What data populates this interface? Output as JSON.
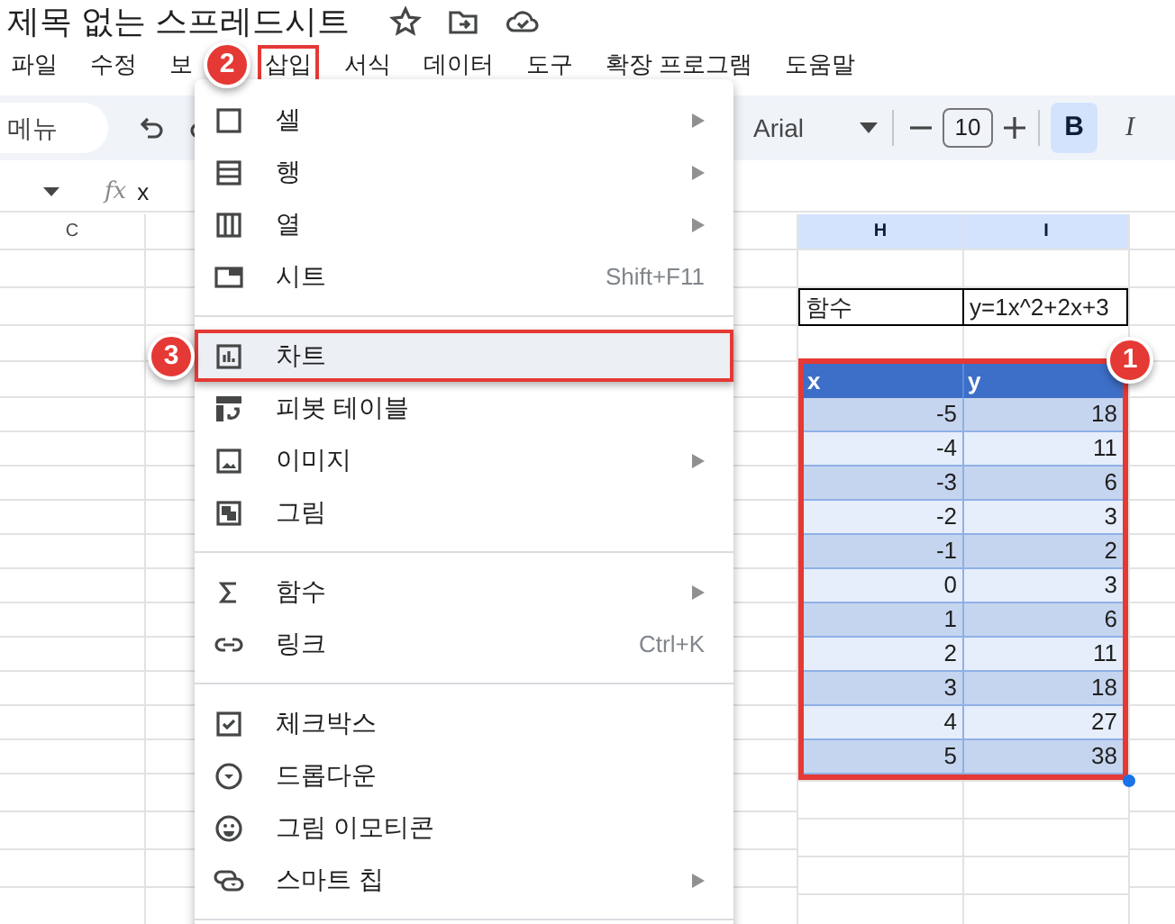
{
  "document": {
    "title": "제목 없는 스프레드시트"
  },
  "menubar": [
    {
      "label": "파일",
      "outlined": false
    },
    {
      "label": "수정",
      "outlined": false
    },
    {
      "label": "보",
      "outlined": false
    },
    {
      "label": "삽입",
      "outlined": true,
      "callout": "2"
    },
    {
      "label": "서식",
      "outlined": false
    },
    {
      "label": "데이터",
      "outlined": false
    },
    {
      "label": "도구",
      "outlined": false
    },
    {
      "label": "확장 프로그램",
      "outlined": false
    },
    {
      "label": "도움말",
      "outlined": false
    }
  ],
  "toolbar": {
    "menu_search": "메뉴",
    "font": "Arial",
    "font_size": "10",
    "bold": {
      "label": "B",
      "selected": true
    },
    "italic": {
      "label": "I",
      "selected": false
    }
  },
  "formula_bar": {
    "fx_label": "fx",
    "formula": "x"
  },
  "columns": [
    {
      "label": "C",
      "selected": false
    },
    {
      "label": "H",
      "selected": true
    },
    {
      "label": "I",
      "selected": true
    }
  ],
  "function_row": {
    "label": "함수",
    "value": "y=1x^2+2x+3"
  },
  "table": {
    "outlined": true,
    "callout": "1",
    "columns": [
      "x",
      "y"
    ],
    "rows": [
      [
        "-5",
        "18"
      ],
      [
        "-4",
        "11"
      ],
      [
        "-3",
        "6"
      ],
      [
        "-2",
        "3"
      ],
      [
        "-1",
        "2"
      ],
      [
        "0",
        "3"
      ],
      [
        "1",
        "6"
      ],
      [
        "2",
        "11"
      ],
      [
        "3",
        "18"
      ],
      [
        "4",
        "27"
      ],
      [
        "5",
        "38"
      ]
    ]
  },
  "insert_menu": {
    "sections": [
      [
        {
          "kind": "cell",
          "label": "셀",
          "submenu": true,
          "highlighted": false,
          "outlined": false
        },
        {
          "kind": "rows",
          "label": "행",
          "submenu": true,
          "highlighted": false,
          "outlined": false
        },
        {
          "kind": "columns",
          "label": "열",
          "submenu": true,
          "highlighted": false,
          "outlined": false
        },
        {
          "kind": "sheet",
          "label": "시트",
          "shortcut": "Shift+F11",
          "submenu": false,
          "highlighted": false,
          "outlined": false
        }
      ],
      [
        {
          "kind": "chart",
          "label": "차트",
          "submenu": false,
          "highlighted": true,
          "outlined": true,
          "callout": "3"
        },
        {
          "kind": "pivot",
          "label": "피봇 테이블",
          "submenu": false,
          "highlighted": false,
          "outlined": false
        },
        {
          "kind": "image",
          "label": "이미지",
          "submenu": true,
          "highlighted": false,
          "outlined": false
        },
        {
          "kind": "drawing",
          "label": "그림",
          "submenu": false,
          "highlighted": false,
          "outlined": false
        }
      ],
      [
        {
          "kind": "function",
          "label": "함수",
          "submenu": true,
          "highlighted": false,
          "outlined": false
        },
        {
          "kind": "link",
          "label": "링크",
          "shortcut": "Ctrl+K",
          "submenu": false,
          "highlighted": false,
          "outlined": false
        }
      ],
      [
        {
          "kind": "checkbox",
          "label": "체크박스",
          "submenu": false,
          "highlighted": false,
          "outlined": false
        },
        {
          "kind": "dropdown",
          "label": "드롭다운",
          "submenu": false,
          "highlighted": false,
          "outlined": false
        },
        {
          "kind": "emoji",
          "label": "그림 이모티콘",
          "submenu": false,
          "highlighted": false,
          "outlined": false
        },
        {
          "kind": "chip",
          "label": "스마트 칩",
          "submenu": true,
          "highlighted": false,
          "outlined": false
        }
      ]
    ]
  }
}
